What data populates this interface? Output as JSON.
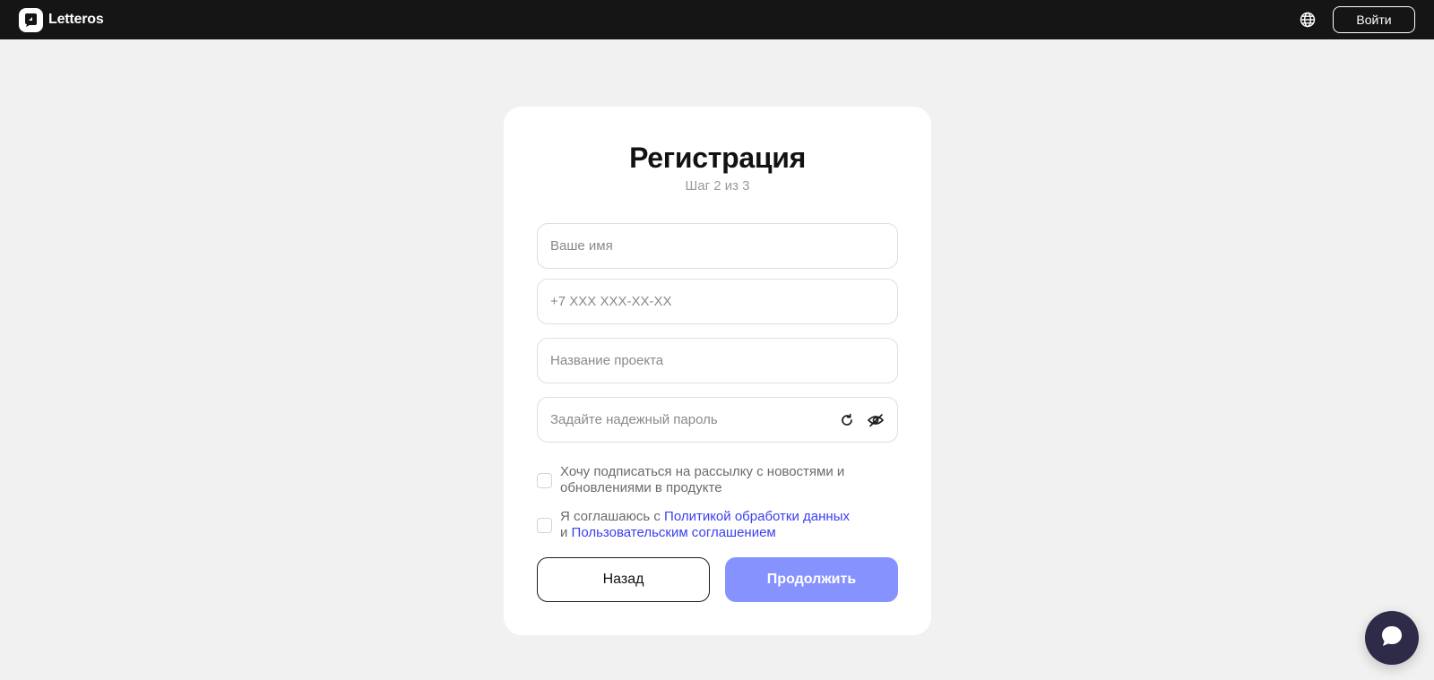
{
  "header": {
    "brand": "Letteros",
    "language_icon": "globe-icon",
    "login_label": "Войти"
  },
  "form": {
    "title": "Регистрация",
    "step": "Шаг 2 из 3",
    "name_placeholder": "Ваше имя",
    "phone_placeholder": "+7 XXX XXX-XX-XX",
    "project_placeholder": "Название проекта",
    "password_placeholder": "Задайте надежный пароль",
    "password_icons": [
      "refresh-icon",
      "eye-off-icon"
    ],
    "newsletter_label_line1": "Хочу подписаться на рассылку с новостями и",
    "newsletter_label_line2": "обновлениями в продукте",
    "consent_prefix": "Я соглашаюсь с ",
    "consent_link1": "Политикой обработки данных",
    "consent_and": "и ",
    "consent_link2": "Пользовательским соглашением",
    "back_label": "Назад",
    "continue_label": "Продолжить"
  },
  "colors": {
    "header_bg": "#151515",
    "page_bg": "#f1f1f1",
    "accent_button": "#8693ff",
    "link": "#3b3ff0",
    "chat_bg": "#2d2b47"
  },
  "chat": {
    "icon": "chat-bubble-icon"
  }
}
